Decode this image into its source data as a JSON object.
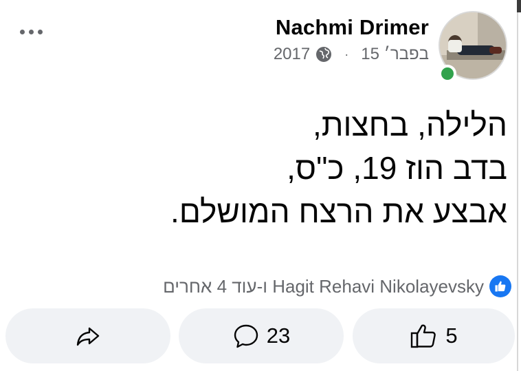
{
  "post": {
    "author": "Nachmi Drimer",
    "date": "15 בפבר׳",
    "year": "2017",
    "separator": "·",
    "privacy_icon": "globe-icon",
    "lines": [
      "הלילה, בחצות,",
      "בדב הוז 19, כ\"ס,",
      "אבצע את הרצח המושלם."
    ]
  },
  "reactions": {
    "summary": "Hagit Rehavi Nikolayevsky ו-עוד 4 אחרים",
    "icon": "like-icon"
  },
  "actions": {
    "like_count": "5",
    "comment_count": "23",
    "share_icon": "share-icon"
  },
  "colors": {
    "accent": "#1877f2",
    "online": "#31a24c",
    "button_bg": "#f0f2f5",
    "muted_text": "#65676b"
  }
}
